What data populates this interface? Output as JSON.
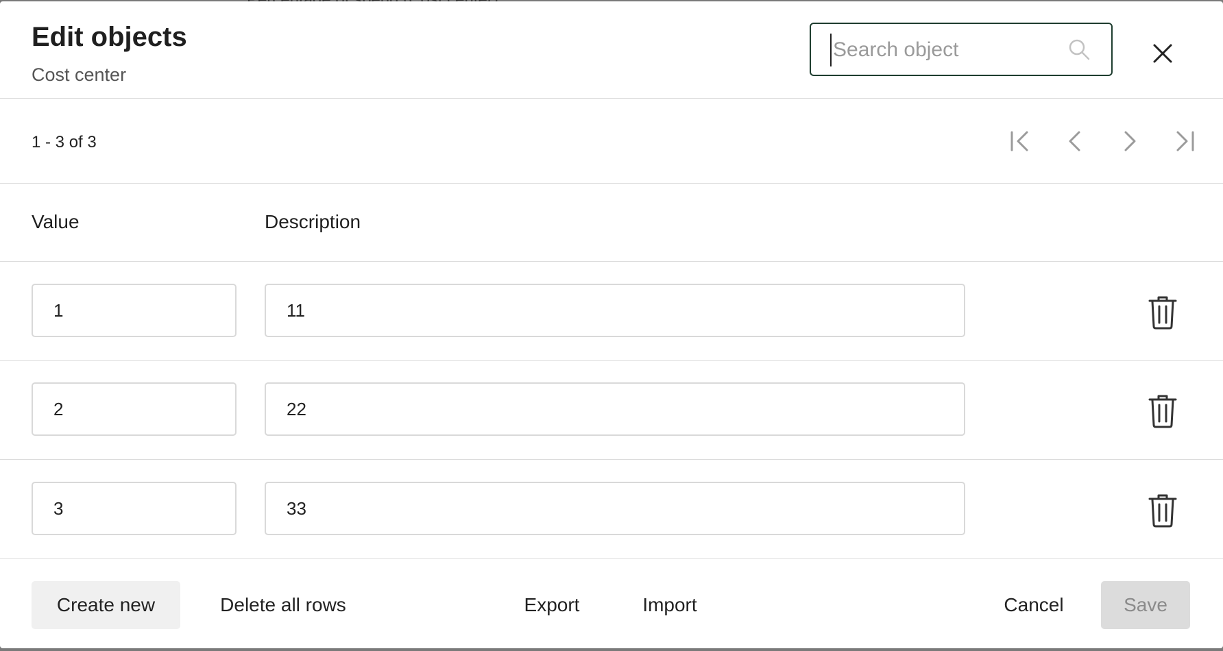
{
  "backdrop": {
    "text": "Percentage of spend (Cost center)"
  },
  "header": {
    "title": "Edit objects",
    "subtitle": "Cost center",
    "search_placeholder": "Search object"
  },
  "pagination": {
    "range_text": "1 - 3 of 3"
  },
  "columns": {
    "value": "Value",
    "description": "Description"
  },
  "rows": [
    {
      "value": "1",
      "description": "11"
    },
    {
      "value": "2",
      "description": "22"
    },
    {
      "value": "3",
      "description": "33"
    }
  ],
  "footer": {
    "create_new": "Create new",
    "delete_all": "Delete all rows",
    "export": "Export",
    "import": "Import",
    "cancel": "Cancel",
    "save": "Save"
  },
  "colors": {
    "search_border": "#1e3d2f",
    "save_disabled_bg": "#dcdcdc",
    "create_bg": "#f0f0f0"
  },
  "icons": [
    "search-icon",
    "close-icon",
    "first-page-icon",
    "prev-page-icon",
    "next-page-icon",
    "last-page-icon",
    "trash-icon"
  ]
}
